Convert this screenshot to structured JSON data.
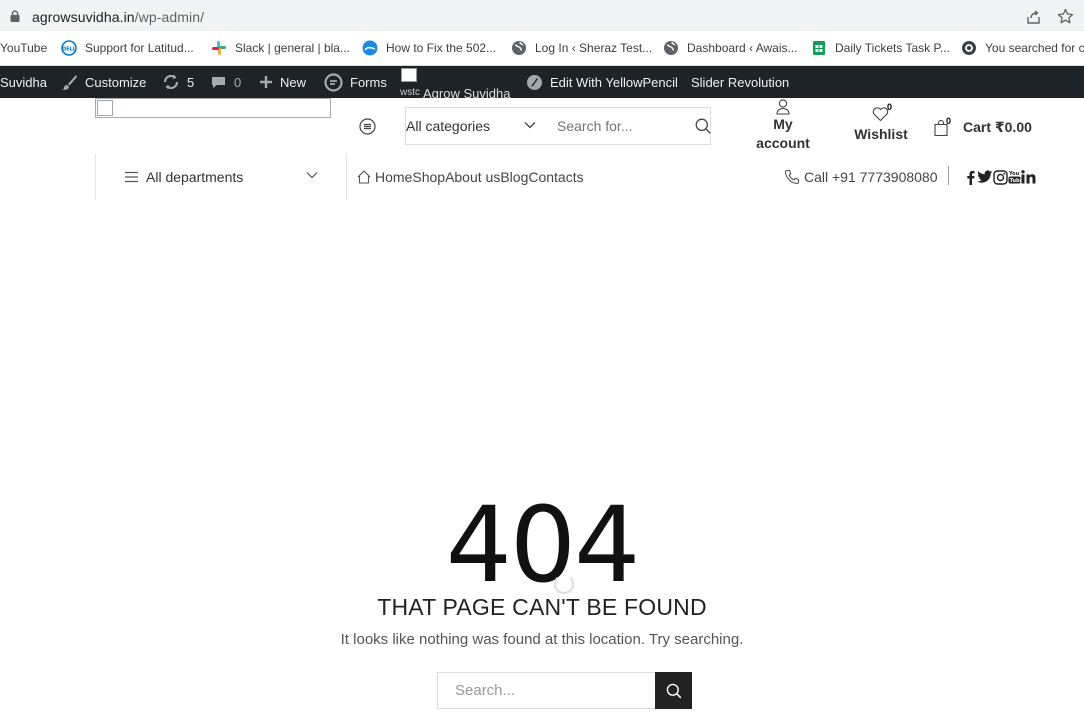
{
  "browser": {
    "url_host": "agrowsuvidha.in",
    "url_path": "/wp-admin/"
  },
  "bookmarks": [
    {
      "label": "YouTube",
      "icon": "youtube-icon"
    },
    {
      "label": "Support for Latitud...",
      "icon": "dell-icon"
    },
    {
      "label": "Slack | general | bla...",
      "icon": "slack-icon"
    },
    {
      "label": "How to Fix the 502...",
      "icon": "web-icon"
    },
    {
      "label": "Log In ‹ Sheraz Test...",
      "icon": "globe-icon"
    },
    {
      "label": "Dashboard ‹ Awais...",
      "icon": "globe-icon"
    },
    {
      "label": "Daily Tickets Task P...",
      "icon": "sheets-icon"
    },
    {
      "label": "You searched for cu",
      "icon": "circle-icon"
    }
  ],
  "wp_admin_bar": {
    "site_name": "Suvidha",
    "customize": "Customize",
    "updates_count": "5",
    "comments_count": "0",
    "new": "New",
    "forms": "Forms",
    "logo_alt_fragment": "wstc",
    "site_link": "Agrow Suvidha",
    "yellow_pencil": "Edit With YellowPencil",
    "slider_revolution": "Slider Revolution"
  },
  "header": {
    "category_select": "All categories",
    "search_placeholder": "Search for...",
    "my_account_line1": "My",
    "my_account_line2": "account",
    "wishlist_label": "Wishlist",
    "wishlist_count": "0",
    "cart_label": "Cart ₹0.00",
    "cart_count": "0"
  },
  "nav": {
    "departments": "All departments",
    "items": [
      "Home",
      "Shop",
      "About us",
      "Blog",
      "Contacts"
    ],
    "phone": "Call +91 7773908080"
  },
  "error_page": {
    "code": "404",
    "heading": "THAT PAGE CAN'T BE FOUND",
    "message": "It looks like nothing was found at this location. Try searching.",
    "search_placeholder": "Search..."
  },
  "colors": {
    "admin_bar_bg": "#1d2327",
    "search_button_bg": "#222222"
  }
}
